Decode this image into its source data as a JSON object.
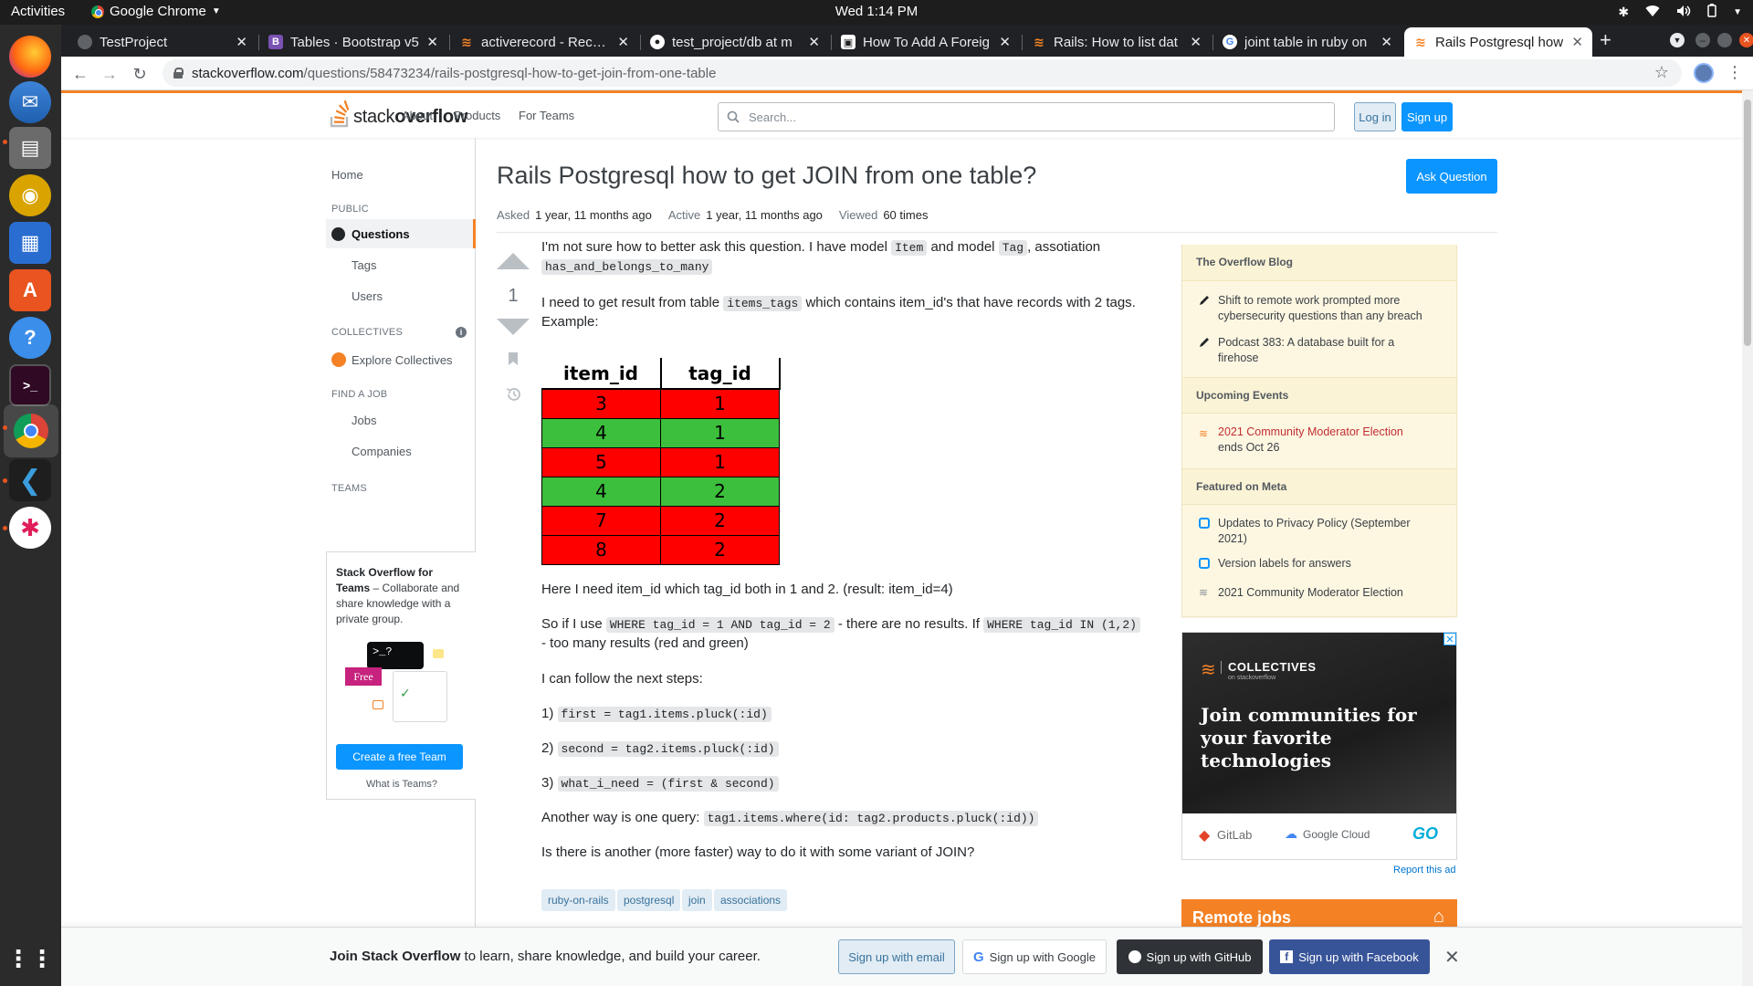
{
  "system": {
    "activities": "Activities",
    "app_name": "Google Chrome",
    "clock": "Wed  1:14 PM"
  },
  "browser": {
    "tabs": [
      {
        "title": "TestProject"
      },
      {
        "title": "Tables · Bootstrap v5"
      },
      {
        "title": "activerecord - Recom"
      },
      {
        "title": "test_project/db at m"
      },
      {
        "title": "How To Add A Foreig"
      },
      {
        "title": "Rails: How to list dat"
      },
      {
        "title": "joint table in ruby on"
      },
      {
        "title": "Rails Postgresql how"
      }
    ],
    "url_host": "stackoverflow.com",
    "url_path": "/questions/58473234/rails-postgresql-how-to-get-join-from-one-table"
  },
  "so": {
    "logo_light": "stack",
    "logo_bold": "overflow",
    "nav": {
      "about": "About",
      "products": "Products",
      "for_teams": "For Teams"
    },
    "search_placeholder": "Search...",
    "login": "Log in",
    "signup": "Sign up"
  },
  "leftnav": {
    "home": "Home",
    "public": "PUBLIC",
    "questions": "Questions",
    "tags": "Tags",
    "users": "Users",
    "collectives": "COLLECTIVES",
    "explore_collectives": "Explore Collectives",
    "find_a_job": "FIND A JOB",
    "jobs": "Jobs",
    "companies": "Companies",
    "teams": "TEAMS",
    "teams_title": "Stack Overflow for Teams",
    "teams_desc": " – Collaborate and share knowledge with a private group.",
    "free_badge": "Free",
    "create_team": "Create a free Team",
    "what_is_teams": "What is Teams?"
  },
  "question": {
    "title": "Rails Postgresql how to get JOIN from one table?",
    "asked_label": "Asked",
    "asked_value": "1 year, 11 months ago",
    "active_label": "Active",
    "active_value": "1 year, 11 months ago",
    "viewed_label": "Viewed",
    "viewed_value": "60 times",
    "ask_button": "Ask Question",
    "votes": "1",
    "p1_a": "I'm not sure how to better ask this question. I have model ",
    "p1_code1": "Item",
    "p1_b": " and model ",
    "p1_code2": "Tag",
    "p1_c": ", assotiation",
    "p1_code3": "has_and_belongs_to_many",
    "p2_a": "I need to get result from table ",
    "p2_code": "items_tags",
    "p2_b": " which contains item_id's that have records with 2 tags.",
    "p2_c": "Example:",
    "table": {
      "headers": [
        "item_id",
        "tag_id"
      ],
      "rows": [
        {
          "item_id": "3",
          "tag_id": "1",
          "color": "red"
        },
        {
          "item_id": "4",
          "tag_id": "1",
          "color": "green"
        },
        {
          "item_id": "5",
          "tag_id": "1",
          "color": "red"
        },
        {
          "item_id": "4",
          "tag_id": "2",
          "color": "green"
        },
        {
          "item_id": "7",
          "tag_id": "2",
          "color": "red"
        },
        {
          "item_id": "8",
          "tag_id": "2",
          "color": "red"
        }
      ]
    },
    "p3": "Here I need item_id which tag_id both in 1 and 2. (result: item_id=4)",
    "p4_a": "So if I use ",
    "p4_code1": "WHERE tag_id = 1 AND tag_id = 2",
    "p4_b": " - there are no results. If ",
    "p4_code2": "WHERE tag_id IN (1,2)",
    "p4_c": "- too many results (red and green)",
    "p5": "I can follow the next steps:",
    "step1_num": "1)",
    "step1_code": "first = tag1.items.pluck(:id)",
    "step2_num": "2)",
    "step2_code": "second = tag2.items.pluck(:id)",
    "step3_num": "3)",
    "step3_code": "what_i_need = (first & second)",
    "p6_a": "Another way is one query: ",
    "p6_code": "tag1.items.where(id: tag2.products.pluck(:id))",
    "p7": "Is there is another (more faster) way to do it with some variant of JOIN?",
    "tags": [
      "ruby-on-rails",
      "postgresql",
      "join",
      "associations"
    ]
  },
  "sidebar": {
    "blog_head": "The Overflow Blog",
    "blog1": "Shift to remote work prompted more cybersecurity questions than any breach",
    "blog2": "Podcast 383: A database built for a firehose",
    "events_head": "Upcoming Events",
    "event1": "2021 Community Moderator Election",
    "event1_sub": "ends Oct 26",
    "meta_head": "Featured on Meta",
    "meta1": "Updates to Privacy Policy (September 2021)",
    "meta2": "Version labels for answers",
    "meta3": "2021 Community Moderator Election",
    "ad_brand": "COLLECTIVES",
    "ad_sub": "on stackoverflow",
    "ad_headline": "Join communities for your favorite technologies",
    "ad_gitlab": "GitLab",
    "ad_gcloud": "Google Cloud",
    "ad_go": "GO",
    "report_ad": "Report this ad",
    "remote_jobs": "Remote jobs"
  },
  "banner": {
    "text_bold": "Join Stack Overflow",
    "text_rest": " to learn, share knowledge, and build your career.",
    "email": "Sign up with email",
    "google": "Sign up with Google",
    "github": "Sign up with GitHub",
    "facebook": "Sign up with Facebook"
  },
  "colors": {
    "so_orange": "#f48225",
    "so_blue": "#0a95ff",
    "row_red": "#ff0000",
    "row_green": "#3cbf3c"
  }
}
